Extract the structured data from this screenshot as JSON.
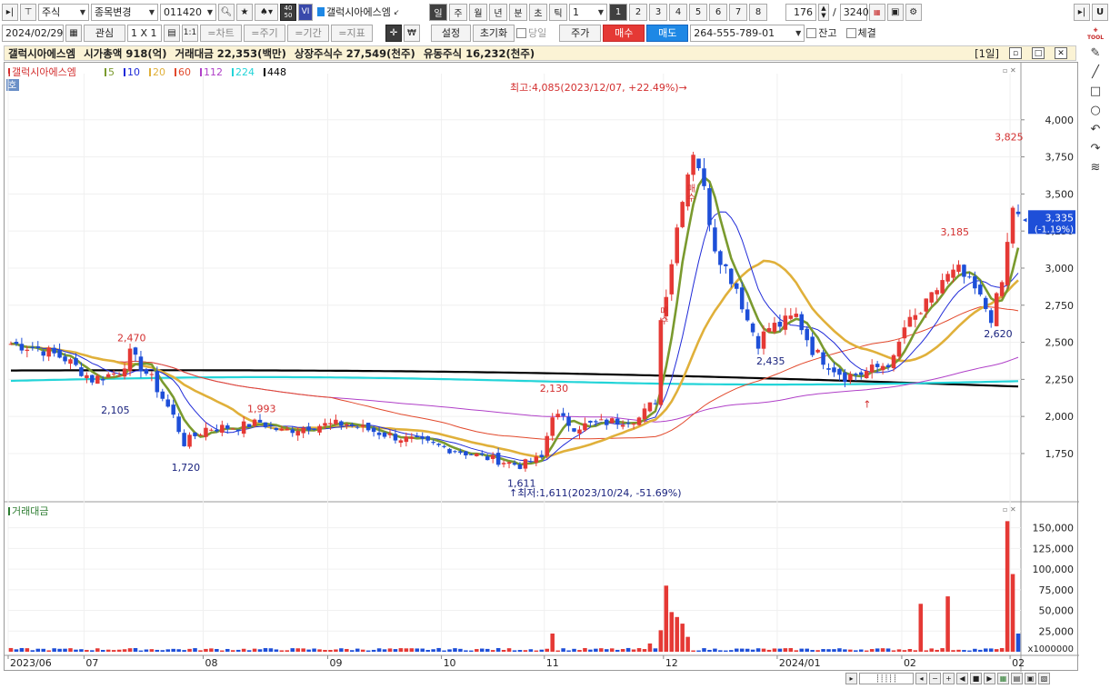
{
  "toolbar1": {
    "market": "주식",
    "change_item": "종목변경",
    "code": "011420",
    "vi_badge": "VI",
    "stock_name": "갤럭시아에스엠",
    "periods": [
      "일",
      "주",
      "월",
      "년",
      "분",
      "초",
      "틱"
    ],
    "period_selected": "일",
    "interval_value": "1",
    "chart_nums": [
      "1",
      "2",
      "3",
      "4",
      "5",
      "6",
      "7",
      "8"
    ],
    "chart_num_selected": "1",
    "count_value": "176",
    "count_sep": "/",
    "count_total": "3240",
    "right_button": "U"
  },
  "toolbar2": {
    "date": "2024/02/29",
    "interest": "관심",
    "layout": "1 X 1",
    "one_one": "1:1",
    "btn_chart": "=차트",
    "btn_stock": "=주기",
    "btn_period": "=기간",
    "btn_indicator": "=지표",
    "won": "₩",
    "settings": "설정",
    "reset": "초기화",
    "same_day": "당일",
    "price": "주가",
    "buy": "매수",
    "sell": "매도",
    "account": "264-555-789-01",
    "balance": "잔고",
    "executed": "체결"
  },
  "info": {
    "name": "갤럭시아에스엠",
    "market_cap": "시가총액 918(억)",
    "trade_amount": "거래대금 22,353(백만)",
    "listed_shares": "상장주식수 27,549(천주)",
    "float_shares": "유동주식 16,232(천주)",
    "window_tag": "[1일]"
  },
  "legend": {
    "badge": "호",
    "stock": "갤럭시아에스엠",
    "items": [
      {
        "label": "5",
        "color": "#7a9a2e"
      },
      {
        "label": "10",
        "color": "#1f2ad8"
      },
      {
        "label": "20",
        "color": "#e0b03a"
      },
      {
        "label": "60",
        "color": "#e2492c"
      },
      {
        "label": "112",
        "color": "#b040c8"
      },
      {
        "label": "224",
        "color": "#23d4d8"
      },
      {
        "label": "448",
        "color": "#000000"
      }
    ]
  },
  "annotations": {
    "high": "최고:4,085(2023/12/07, +22.49%)",
    "low": "최저:1,611(2023/10/24, -51.69%)",
    "buy_signal": "매수",
    "price_labels": [
      {
        "text": "2,470",
        "price": 2470,
        "idx": 22,
        "color": "#d32f2f"
      },
      {
        "text": "2,105",
        "price": 2105,
        "idx": 19,
        "color": "#1a237e"
      },
      {
        "text": "1,720",
        "price": 1720,
        "idx": 32,
        "color": "#1a237e"
      },
      {
        "text": "1,993",
        "price": 1993,
        "idx": 46,
        "color": "#d32f2f"
      },
      {
        "text": "2,130",
        "price": 2130,
        "idx": 100,
        "color": "#d32f2f"
      },
      {
        "text": "1,611",
        "price": 1611,
        "idx": 94,
        "color": "#1a237e"
      },
      {
        "text": "2,435",
        "price": 2435,
        "idx": 140,
        "color": "#1a237e"
      },
      {
        "text": "3,185",
        "price": 3185,
        "idx": 174,
        "color": "#d32f2f"
      },
      {
        "text": "2,620",
        "price": 2620,
        "idx": 182,
        "color": "#1a237e"
      },
      {
        "text": "3,825",
        "price": 3825,
        "idx": 184,
        "color": "#d32f2f"
      }
    ]
  },
  "current": {
    "price": "3,335",
    "change": "(-1.19%)"
  },
  "volume_panel": {
    "title": "거래대금",
    "unit": "x1000000"
  },
  "chart_data": {
    "type": "candlestick",
    "price_axis": {
      "ticks": [
        1750,
        2000,
        2250,
        2500,
        2750,
        3000,
        3250,
        3500,
        3750,
        4000
      ],
      "ylim": [
        1480,
        4250
      ]
    },
    "volume_axis": {
      "ticks": [
        25000,
        50000,
        75000,
        100000,
        125000,
        150000
      ],
      "ylim": [
        0,
        165000
      ]
    },
    "x_labels": [
      {
        "text": "2023/06",
        "idx": 0
      },
      {
        "text": "07",
        "idx": 14
      },
      {
        "text": "08",
        "idx": 36
      },
      {
        "text": "09",
        "idx": 59
      },
      {
        "text": "10",
        "idx": 80
      },
      {
        "text": "11",
        "idx": 99
      },
      {
        "text": "12",
        "idx": 121
      },
      {
        "text": "2024/01",
        "idx": 142
      },
      {
        "text": "02",
        "idx": 165
      },
      {
        "text": "02",
        "idx": 185
      }
    ],
    "anchors": [
      [
        0,
        2490
      ],
      [
        5,
        2460
      ],
      [
        10,
        2390
      ],
      [
        15,
        2250
      ],
      [
        20,
        2300
      ],
      [
        22,
        2420
      ],
      [
        26,
        2250
      ],
      [
        30,
        2000
      ],
      [
        32,
        1820
      ],
      [
        36,
        1920
      ],
      [
        42,
        1930
      ],
      [
        46,
        1960
      ],
      [
        50,
        1900
      ],
      [
        56,
        1940
      ],
      [
        62,
        1950
      ],
      [
        70,
        1870
      ],
      [
        80,
        1790
      ],
      [
        88,
        1720
      ],
      [
        94,
        1670
      ],
      [
        98,
        1720
      ],
      [
        100,
        2020
      ],
      [
        104,
        1930
      ],
      [
        110,
        1960
      ],
      [
        116,
        1990
      ],
      [
        119,
        2110
      ],
      [
        120,
        2650
      ],
      [
        122,
        3050
      ],
      [
        124,
        3500
      ],
      [
        126,
        3800
      ],
      [
        127,
        3700
      ],
      [
        130,
        3150
      ],
      [
        132,
        3000
      ],
      [
        134,
        2870
      ],
      [
        136,
        2650
      ],
      [
        138,
        2500
      ],
      [
        140,
        2600
      ],
      [
        142,
        2620
      ],
      [
        145,
        2680
      ],
      [
        148,
        2450
      ],
      [
        151,
        2350
      ],
      [
        154,
        2270
      ],
      [
        157,
        2290
      ],
      [
        160,
        2330
      ],
      [
        163,
        2380
      ],
      [
        165,
        2600
      ],
      [
        168,
        2700
      ],
      [
        170,
        2800
      ],
      [
        172,
        2920
      ],
      [
        175,
        2980
      ],
      [
        178,
        2850
      ],
      [
        181,
        2670
      ],
      [
        183,
        2900
      ],
      [
        185,
        3420
      ],
      [
        186,
        3335
      ]
    ],
    "high": {
      "value": 4085,
      "date": "2023/12/07"
    },
    "low": {
      "value": 1611,
      "date": "2023/10/24"
    },
    "volume_spikes": [
      [
        100,
        22000
      ],
      [
        118,
        10000
      ],
      [
        120,
        26000
      ],
      [
        121,
        80000
      ],
      [
        122,
        48000
      ],
      [
        123,
        42000
      ],
      [
        124,
        34000
      ],
      [
        125,
        18000
      ],
      [
        168,
        58000
      ],
      [
        173,
        67000
      ],
      [
        184,
        158000
      ],
      [
        185,
        94000
      ],
      [
        186,
        22000
      ]
    ]
  }
}
